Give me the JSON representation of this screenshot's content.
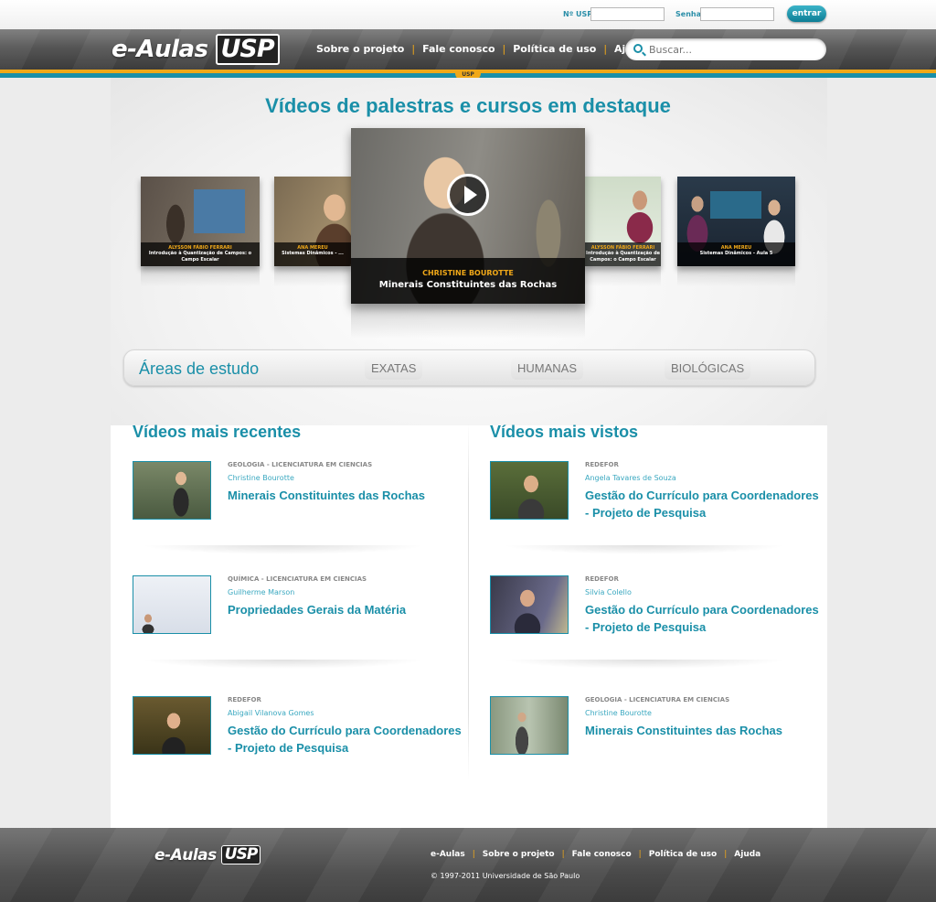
{
  "login": {
    "usp_label": "Nº USP",
    "senha_label": "Senha",
    "submit_label": "entrar"
  },
  "header": {
    "logo_text": "e-Aulas",
    "logo_usp": "USP",
    "usp_tab": "USP",
    "nav": [
      "Sobre o projeto",
      "Fale conosco",
      "Política de uso",
      "Ajuda"
    ],
    "search_placeholder": "Buscar..."
  },
  "featured": {
    "title": "Vídeos de palestras e cursos em destaque",
    "main": {
      "author": "CHRISTINE BOUROTTE",
      "title": "Minerais Constituintes das Rochas"
    },
    "thumbs": [
      {
        "author": "ALYSSON FÁBIO FERRARI",
        "title": "Introdução à Quantização de Campos: o Campo Escalar"
      },
      {
        "author": "ANA MEREU",
        "title": "Sistemas Dinâmicos - ..."
      },
      {
        "author": "ALYSSON FÁBIO FERRARI",
        "title": "Introdução à Quantização de Campos: o Campo Escalar"
      },
      {
        "author": "ANA MEREU",
        "title": "Sistemas Dinâmicos - Aula 5"
      }
    ]
  },
  "areas": {
    "title": "Áreas de estudo",
    "buttons": [
      "EXATAS",
      "HUMANAS",
      "BIOLÓGICAS"
    ]
  },
  "recent": {
    "title": "Vídeos mais recentes",
    "items": [
      {
        "category": "GEOLOGIA - LICENCIATURA EM CIENCIAS",
        "author": "Christine Bourotte",
        "title": "Minerais Constituintes das Rochas"
      },
      {
        "category": "QUÍMICA - LICENCIATURA EM CIENCIAS",
        "author": "Guilherme Marson",
        "title": "Propriedades Gerais da Matéria"
      },
      {
        "category": "REDEFOR",
        "author": "Abigail Vilanova Gomes",
        "title": "Gestão do Currículo para Coordenadores - Projeto de Pesquisa"
      }
    ]
  },
  "viewed": {
    "title": "Vídeos mais vistos",
    "items": [
      {
        "category": "REDEFOR",
        "author": "Angela Tavares de Souza",
        "title": "Gestão do Currículo para Coordenadores - Projeto de Pesquisa"
      },
      {
        "category": "REDEFOR",
        "author": "Silvia Colello",
        "title": "Gestão do Currículo para Coordenadores - Projeto de Pesquisa"
      },
      {
        "category": "GEOLOGIA - LICENCIATURA EM CIENCIAS",
        "author": "Christine Bourotte",
        "title": "Minerais Constituintes das Rochas"
      }
    ]
  },
  "footer": {
    "logo_text": "e-Aulas",
    "logo_usp": "USP",
    "nav": [
      "e-Aulas",
      "Sobre o projeto",
      "Fale conosco",
      "Política de uso",
      "Ajuda"
    ],
    "copyright": "© 1997-2011 Universidade de São Paulo"
  },
  "colors": {
    "accent": "#1a8fa8",
    "highlight": "#f0a818",
    "header": "#555555"
  }
}
